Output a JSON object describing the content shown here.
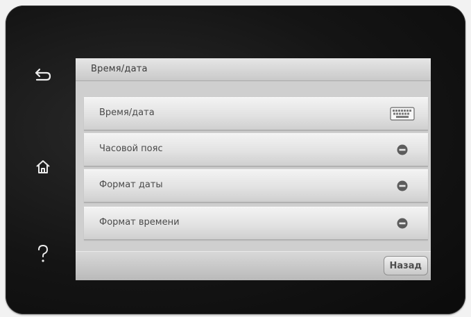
{
  "side_buttons": {
    "back": "back-icon",
    "home": "home-icon",
    "help": "help-icon"
  },
  "screen": {
    "title": "Время/дата",
    "items": [
      {
        "label": "Время/дата",
        "icon": "keyboard-icon"
      },
      {
        "label": "Часовой пояс",
        "icon": "dot-icon"
      },
      {
        "label": "Формат даты",
        "icon": "dot-icon"
      },
      {
        "label": "Формат времени",
        "icon": "dot-icon"
      }
    ],
    "back_label": "Назад"
  }
}
